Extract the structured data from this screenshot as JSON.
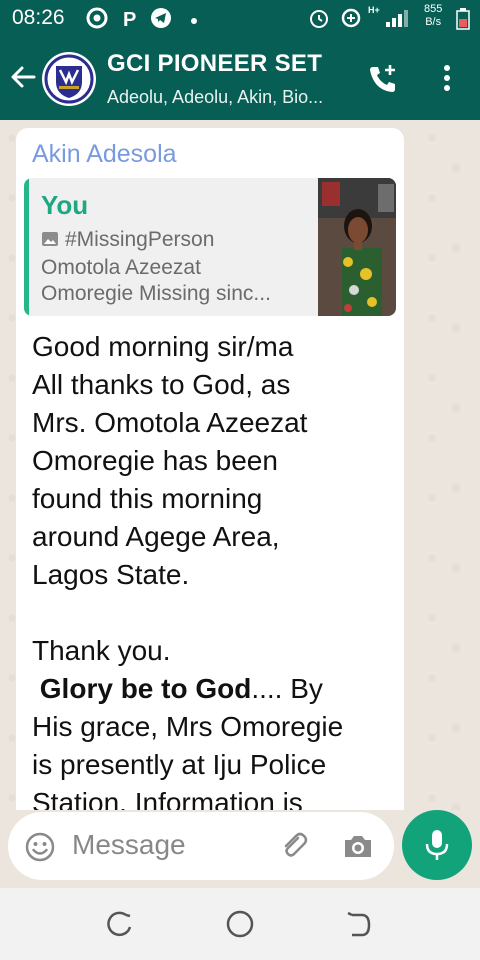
{
  "status_bar": {
    "time": "08:26",
    "net_speed_value": "855",
    "net_speed_unit": "B/s",
    "network_label": "H+"
  },
  "header": {
    "title": "GCI PIONEER SET",
    "subtitle": "Adeolu, Adeolu, Akin, Bio...",
    "accent_color": "#075e54"
  },
  "message": {
    "sender": "Akin Adesola",
    "sender_color": "#7a9ae0",
    "quote": {
      "author": "You",
      "line1": "#MissingPerson",
      "line2": "Omotola Azeezat",
      "line3": "Omoregie  Missing sinc..."
    },
    "lines": [
      "Good morning sir/ma",
      "All thanks to God, as",
      "Mrs. Omotola Azeezat",
      "Omoregie has been",
      "found this morning",
      "around Agege Area,",
      "Lagos State."
    ],
    "thanks": "Thank you.",
    "glory_bold": "Glory be to God",
    "glory_rest": ".... By",
    "tail_lines": [
      "His grace, Mrs Omoregie",
      "is presently at Iju Police",
      "Station. Information is"
    ]
  },
  "composer": {
    "placeholder": "Message",
    "mic_color": "#12a37a"
  },
  "icons": {
    "back": "arrow-left-icon",
    "call_add": "phone-plus-icon",
    "more": "more-vertical-icon",
    "emoji": "emoji-icon",
    "attach": "paperclip-icon",
    "camera": "camera-icon",
    "mic": "microphone-icon"
  }
}
